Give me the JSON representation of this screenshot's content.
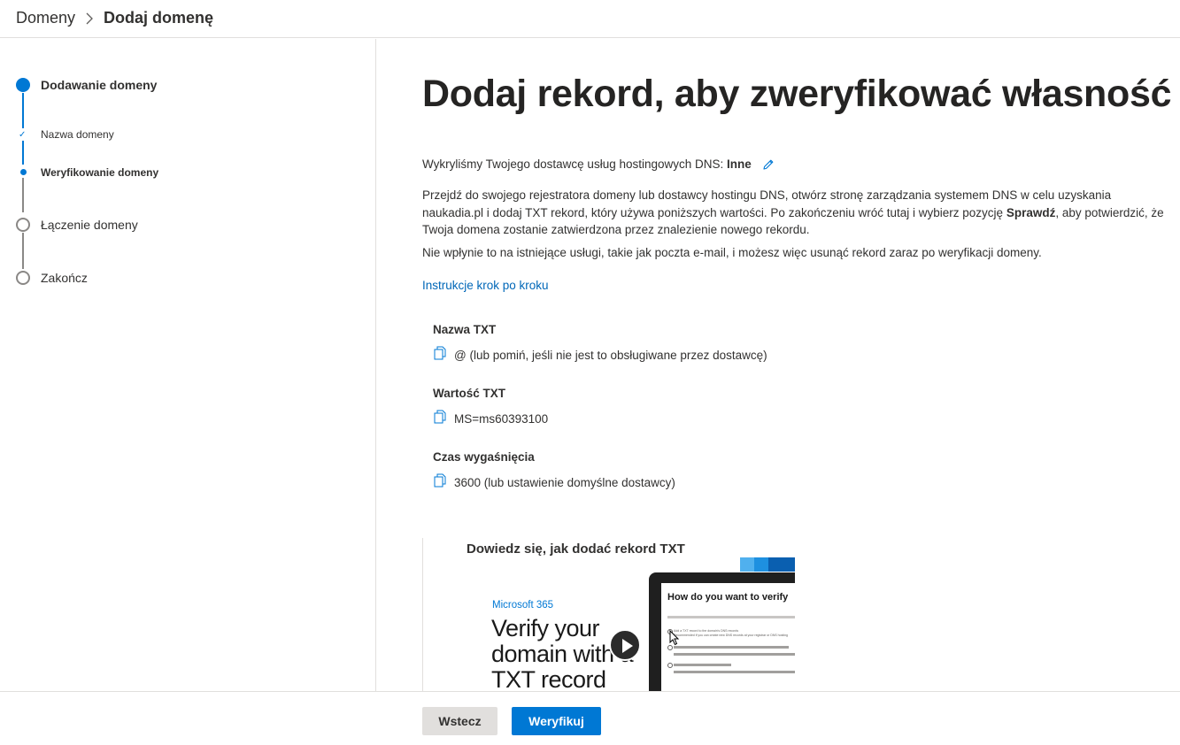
{
  "breadcrumb": {
    "root": "Domeny",
    "current": "Dodaj domenę"
  },
  "steps": {
    "adding": "Dodawanie domeny",
    "domain_name": "Nazwa domeny",
    "verify": "Weryfikowanie domeny",
    "connect": "Łączenie domeny",
    "finish": "Zakończ"
  },
  "main": {
    "title": "Dodaj rekord, aby zweryfikować własność",
    "detected_prefix": "Wykryliśmy Twojego dostawcę usług hostingowych DNS: ",
    "detected_provider": "Inne",
    "p1_a": "Przejdź do swojego rejestratora domeny lub dostawcy hostingu DNS, otwórz stronę zarządzania systemem DNS w celu uzyskania naukadia.pl i dodaj TXT rekord, który używa poniższych wartości. Po zakończeniu wróć tutaj i wybierz pozycję ",
    "p1_bold": "Sprawdź",
    "p1_b": ", aby potwierdzić, że Twoja domena zostanie zatwierdzona przez znalezienie nowego rekordu.",
    "p2": "Nie wpłynie to na istniejące usługi, takie jak poczta e-mail, i możesz więc usunąć rekord zaraz po weryfikacji domeny.",
    "instructions_link": "Instrukcje krok po kroku"
  },
  "record": {
    "name_label": "Nazwa TXT",
    "name_value": "@ (lub pomiń, jeśli nie jest to obsługiwane przez dostawcę)",
    "value_label": "Wartość TXT",
    "value_value": "MS=ms60393100",
    "ttl_label": "Czas wygaśnięcia",
    "ttl_value": "3600 (lub ustawienie domyślne dostawcy)"
  },
  "video": {
    "title": "Dowiedz się, jak dodać rekord TXT",
    "brand": "Microsoft 365",
    "headline": "Verify your domain with a TXT record",
    "screen_title": "How do you want to verify",
    "option_1": "Add a TXT record to the domain's DNS records",
    "option_1_note": "Recommended if you can create new DNS records at your registrar or DNS hosting"
  },
  "footer": {
    "back": "Wstecz",
    "verify": "Weryfikuj"
  },
  "colors": {
    "accent": "#0078d4",
    "link": "#0067b8",
    "inactive_step": "#8a8886"
  },
  "icons": [
    "chevron-right-icon",
    "check-icon",
    "edit-pencil-icon",
    "copy-icon",
    "play-icon",
    "mouse-cursor-icon"
  ]
}
